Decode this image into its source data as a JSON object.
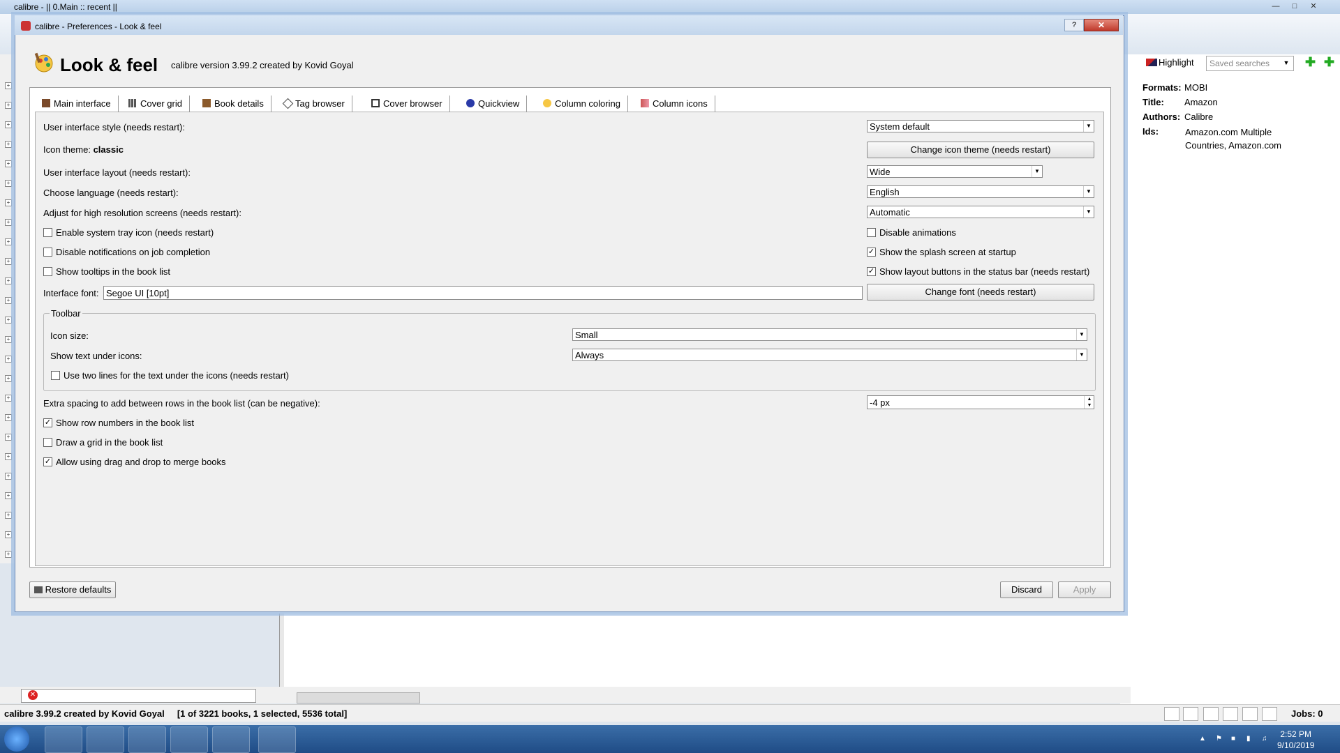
{
  "window": {
    "title": "calibre - || 0.Main :: recent ||",
    "min_icon": "minimize-icon",
    "max_icon": "maximize-icon",
    "close_icon": "close-icon"
  },
  "right_panel": {
    "highlight_label": "Highlight",
    "saved_searches_placeholder": "Saved searches",
    "book_details": {
      "formats_key": "Formats:",
      "formats_val": "MOBI",
      "title_key": "Title:",
      "title_val": "Amazon",
      "authors_key": "Authors:",
      "authors_val": "Calibre",
      "ids_key": "Ids:",
      "ids_val": "Amazon.com Multiple Countries, Amazon.com"
    }
  },
  "status_bar": {
    "text": "calibre 3.99.2 created by Kovid Goyal     [1 of 3221 books, 1 selected, 5536 total]",
    "jobs": "Jobs: 0"
  },
  "taskbar": {
    "time": "2:52 PM",
    "date": "9/10/2019"
  },
  "dialog": {
    "title": "calibre - Preferences - Look & feel",
    "help_label": "?",
    "close_label": "✕",
    "heading": "Look & feel",
    "version": "calibre version 3.99.2 created by Kovid Goyal",
    "tabs": [
      {
        "label": "Main interface",
        "icon": "book-icon"
      },
      {
        "label": "Cover grid",
        "icon": "grid-icon"
      },
      {
        "label": "Book details",
        "icon": "book-details-icon"
      },
      {
        "label": "Tag browser",
        "icon": "tag-icon"
      },
      {
        "label": "Cover browser",
        "icon": "cover-browser-icon"
      },
      {
        "label": "Quickview",
        "icon": "quickview-icon"
      },
      {
        "label": "Column coloring",
        "icon": "column-coloring-icon"
      },
      {
        "label": "Column icons",
        "icon": "column-icons-icon"
      }
    ],
    "ui_style_label": "User interface style (needs restart):",
    "ui_style_value": "System default",
    "icon_theme_label": "Icon theme:",
    "icon_theme_value": "classic",
    "change_icon_theme_btn": "Change icon theme (needs restart)",
    "ui_layout_label": "User interface layout (needs restart):",
    "ui_layout_value": "Wide",
    "language_label": "Choose language (needs restart):",
    "language_value": "English",
    "hires_label": "Adjust for high resolution screens (needs restart):",
    "hires_value": "Automatic",
    "checkboxes_left": [
      {
        "label": "Enable system tray icon (needs restart)",
        "checked": false
      },
      {
        "label": "Disable notifications on job completion",
        "checked": false
      },
      {
        "label": "Show tooltips in the book list",
        "checked": false
      }
    ],
    "checkboxes_right": [
      {
        "label": "Disable animations",
        "checked": false
      },
      {
        "label": "Show the splash screen at startup",
        "checked": true
      },
      {
        "label": "Show layout buttons in the status bar (needs restart)",
        "checked": true
      }
    ],
    "interface_font_label": "Interface font:",
    "interface_font_value": "Segoe UI [10pt]",
    "change_font_btn": "Change font (needs restart)",
    "toolbar_group": {
      "label": "Toolbar",
      "icon_size_label": "Icon size:",
      "icon_size_value": "Small",
      "text_under_label": "Show text under icons:",
      "text_under_value": "Always",
      "two_lines_label": "Use two lines for the text under the icons (needs restart)",
      "two_lines_checked": false
    },
    "spacing_label": "Extra spacing to add between rows in the book list (can be negative):",
    "spacing_value": "-4 px",
    "checkboxes_bottom": [
      {
        "label": "Show row numbers in the book list",
        "checked": true
      },
      {
        "label": "Draw a grid in the book list",
        "checked": false
      },
      {
        "label": "Allow using drag and drop to merge books",
        "checked": true
      }
    ],
    "restore_btn": "Restore defaults",
    "discard_btn": "Discard",
    "apply_btn": "Apply"
  }
}
